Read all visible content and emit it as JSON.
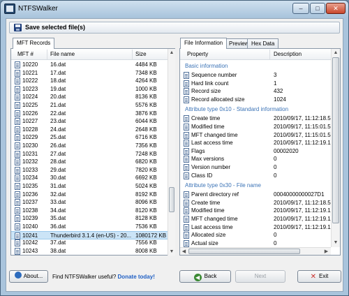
{
  "window": {
    "title": "NTFSWalker",
    "controls": {
      "minimize": "–",
      "maximize": "□",
      "close": "✕"
    }
  },
  "toolbar": {
    "save_label": "Save selected file(s)"
  },
  "left_tabs": [
    "MFT Records"
  ],
  "mft_table": {
    "columns": [
      "MFT #",
      "File name",
      "Size"
    ],
    "rows": [
      {
        "mft": "10220",
        "name": "16.dat",
        "size": "4484 KB"
      },
      {
        "mft": "10221",
        "name": "17.dat",
        "size": "7348 KB"
      },
      {
        "mft": "10222",
        "name": "18.dat",
        "size": "4264 KB"
      },
      {
        "mft": "10223",
        "name": "19.dat",
        "size": "1000 KB"
      },
      {
        "mft": "10224",
        "name": "20.dat",
        "size": "8136 KB"
      },
      {
        "mft": "10225",
        "name": "21.dat",
        "size": "5576 KB"
      },
      {
        "mft": "10226",
        "name": "22.dat",
        "size": "3876 KB"
      },
      {
        "mft": "10227",
        "name": "23.dat",
        "size": "6044 KB"
      },
      {
        "mft": "10228",
        "name": "24.dat",
        "size": "2648 KB"
      },
      {
        "mft": "10229",
        "name": "25.dat",
        "size": "6716 KB"
      },
      {
        "mft": "10230",
        "name": "26.dat",
        "size": "7356 KB"
      },
      {
        "mft": "10231",
        "name": "27.dat",
        "size": "7248 KB"
      },
      {
        "mft": "10232",
        "name": "28.dat",
        "size": "6820 KB"
      },
      {
        "mft": "10233",
        "name": "29.dat",
        "size": "7820 KB"
      },
      {
        "mft": "10234",
        "name": "30.dat",
        "size": "6692 KB"
      },
      {
        "mft": "10235",
        "name": "31.dat",
        "size": "5024 KB"
      },
      {
        "mft": "10236",
        "name": "32.dat",
        "size": "8192 KB"
      },
      {
        "mft": "10237",
        "name": "33.dat",
        "size": "8096 KB"
      },
      {
        "mft": "10238",
        "name": "34.dat",
        "size": "8120 KB"
      },
      {
        "mft": "10239",
        "name": "35.dat",
        "size": "8128 KB"
      },
      {
        "mft": "10240",
        "name": "36.dat",
        "size": "7536 KB"
      },
      {
        "mft": "10241",
        "name": "Thunderbird 3.1.4 (en-US) - 20...",
        "size": "1080172 KB",
        "selected": true
      },
      {
        "mft": "10242",
        "name": "37.dat",
        "size": "7556 KB"
      },
      {
        "mft": "10243",
        "name": "38.dat",
        "size": "8008 KB"
      }
    ]
  },
  "right_tabs": [
    "File Information",
    "Preview",
    "Hex Data"
  ],
  "info_table": {
    "columns": [
      "Property",
      "Description"
    ],
    "groups": [
      {
        "title": "Basic information",
        "rows": [
          {
            "prop": "Sequence number",
            "value": "3"
          },
          {
            "prop": "Hard link count",
            "value": "1"
          },
          {
            "prop": "Record size",
            "value": "432"
          },
          {
            "prop": "Record allocated size",
            "value": "1024"
          }
        ]
      },
      {
        "title": "Attribute type 0x10 - Standard information",
        "rows": [
          {
            "prop": "Create time",
            "value": "2010/09/17, 11:12:18.5"
          },
          {
            "prop": "Modified time",
            "value": "2010/09/17, 11:15:01.5"
          },
          {
            "prop": "MFT changed time",
            "value": "2010/09/17, 11:15:01.5"
          },
          {
            "prop": "Last access time",
            "value": "2010/09/17, 11:12:19.1"
          },
          {
            "prop": "Flags",
            "value": "00002020"
          },
          {
            "prop": "Max versions",
            "value": "0"
          },
          {
            "prop": "Version number",
            "value": "0"
          },
          {
            "prop": "Class ID",
            "value": "0"
          }
        ]
      },
      {
        "title": "Attribute type 0x30 - File name",
        "rows": [
          {
            "prop": "Parent directory ref",
            "value": "00040000000027D1"
          },
          {
            "prop": "Create time",
            "value": "2010/09/17, 11:12:18.5"
          },
          {
            "prop": "Modified time",
            "value": "2010/09/17, 11:12:19.1"
          },
          {
            "prop": "MFT changed time",
            "value": "2010/09/17, 11:12:19.1"
          },
          {
            "prop": "Last access time",
            "value": "2010/09/17, 11:12:19.1"
          },
          {
            "prop": "Allocated size",
            "value": "0"
          },
          {
            "prop": "Actual size",
            "value": "0"
          }
        ]
      }
    ]
  },
  "footer": {
    "about_label": "About...",
    "promo_text": "Find NTFSWalker useful?",
    "donate_label": "Donate today!",
    "back_label": "Back",
    "next_label": "Next",
    "exit_label": "Exit"
  }
}
